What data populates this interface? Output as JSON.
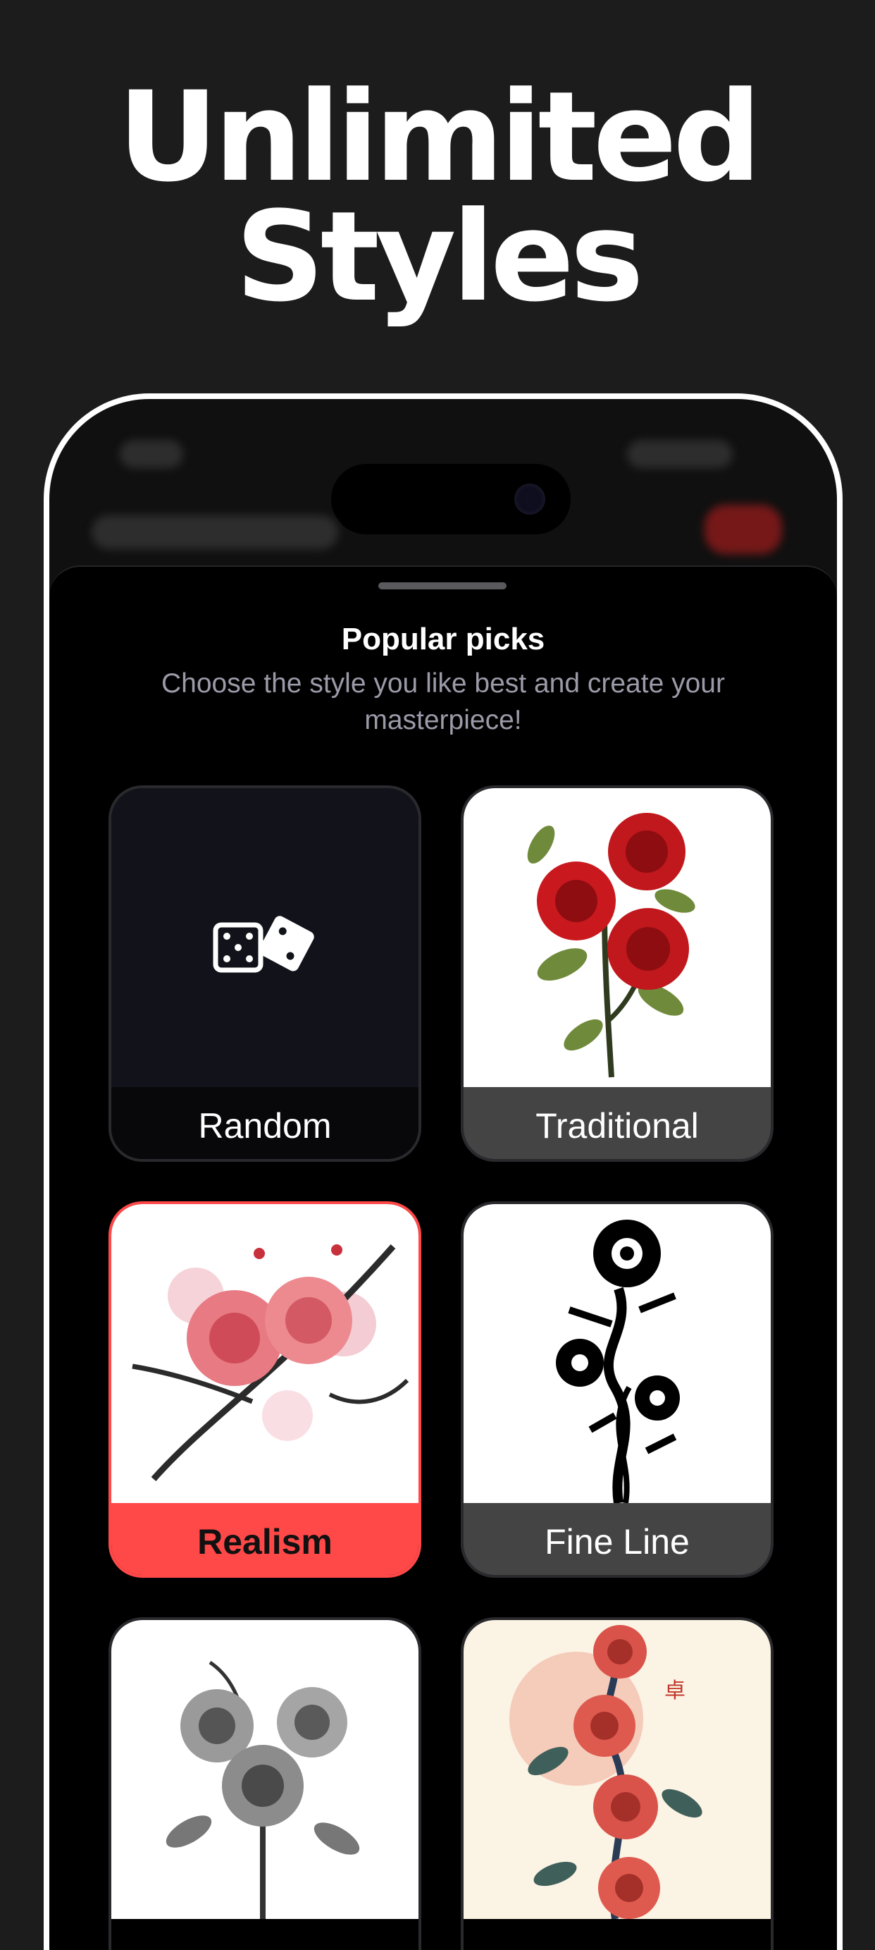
{
  "hero": {
    "line1": "Unlimited",
    "line2": "Styles"
  },
  "sheet": {
    "title": "Popular picks",
    "subtitle": "Choose the style you like best and create your masterpiece!"
  },
  "styles": [
    {
      "label": "Random",
      "icon": "dice-icon",
      "selected": false
    },
    {
      "label": "Traditional",
      "selected": false
    },
    {
      "label": "Realism",
      "selected": true
    },
    {
      "label": "Fine Line",
      "selected": false
    },
    {
      "label": "",
      "selected": false
    },
    {
      "label": "",
      "selected": false
    }
  ],
  "colors": {
    "background": "#1c1c1c",
    "accent": "#ff4848",
    "sheet": "#000000",
    "label_gray": "#444444"
  }
}
